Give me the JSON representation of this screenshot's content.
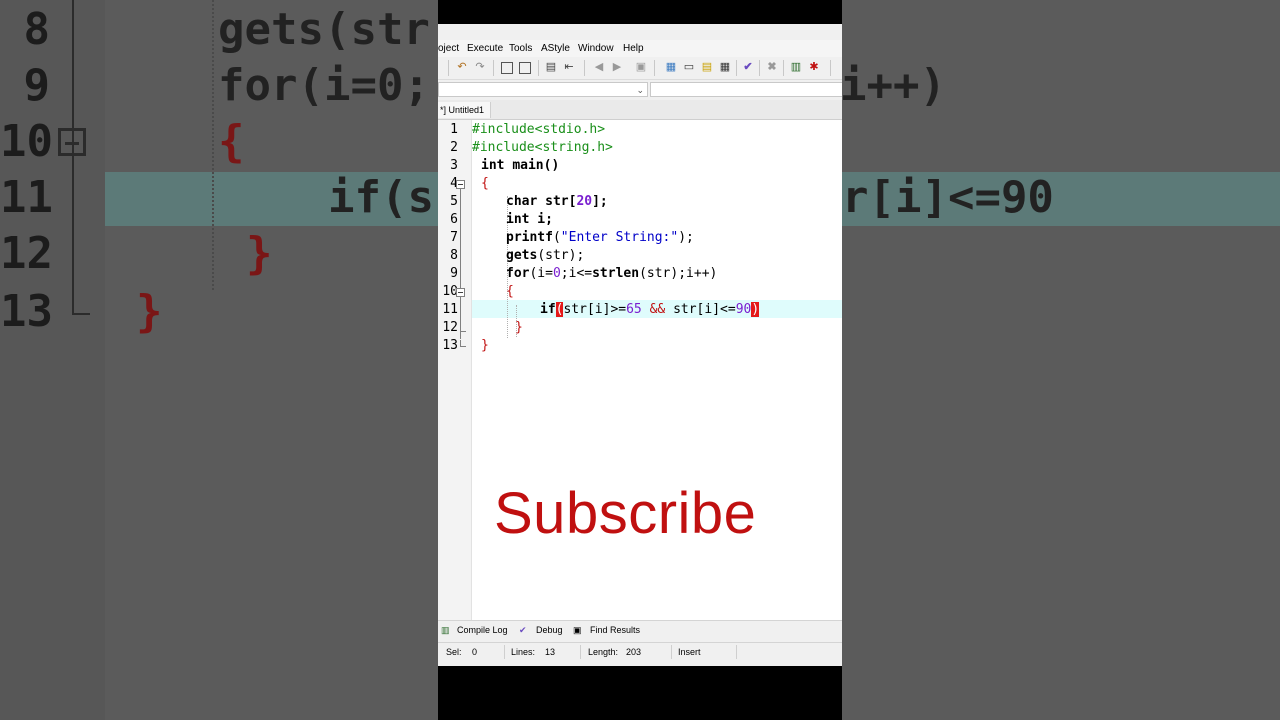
{
  "menu": {
    "items": [
      "oject",
      "Execute",
      "Tools",
      "AStyle",
      "Window",
      "Help"
    ]
  },
  "toolbar": {
    "icons": [
      "undo-icon",
      "redo-icon",
      "find-icon",
      "replace-icon",
      "indent-icon",
      "unindent-icon",
      "back-icon",
      "forward-icon",
      "bookmark-icon",
      "grid-icon",
      "window-icon",
      "layout-icon",
      "tile-icon",
      "check-icon",
      "close-icon",
      "chart-icon",
      "bug-icon"
    ]
  },
  "tab": {
    "label": "*] Untitled1"
  },
  "editor": {
    "line_numbers": [
      "1",
      "2",
      "3",
      "4",
      "5",
      "6",
      "7",
      "8",
      "9",
      "10",
      "11",
      "12",
      "13"
    ],
    "lines": [
      "#include<stdio.h>",
      "#include<string.h>",
      "int main()",
      "{",
      "char str[20];",
      "int i;",
      "printf(\"Enter String:\");",
      "gets(str);",
      "for(i=0;i<=strlen(str);i++)",
      "{",
      "if(str[i]>=65 && str[i]<=90)",
      "}",
      "}"
    ]
  },
  "overlay": {
    "text": "Subscribe"
  },
  "bottom_tabs": {
    "compile_log": "Compile Log",
    "debug": "Debug",
    "find_results": "Find Results"
  },
  "status": {
    "sel_label": "Sel:",
    "sel_value": "0",
    "lines_label": "Lines:",
    "lines_value": "13",
    "length_label": "Length:",
    "length_value": "203",
    "mode": "Insert"
  },
  "background": {
    "numbers": [
      "8",
      "9",
      "10",
      "11",
      "12",
      "13"
    ],
    "code": [
      "gets(str",
      "for(i=0;",
      "{",
      "if(s",
      "r[i]<=90",
      "}",
      "}"
    ],
    "tail": [
      "i++)"
    ]
  },
  "colors": {
    "accent_red": "#c01010",
    "highlight": "#dffcfc",
    "preprocessor": "#1a8f1a"
  }
}
